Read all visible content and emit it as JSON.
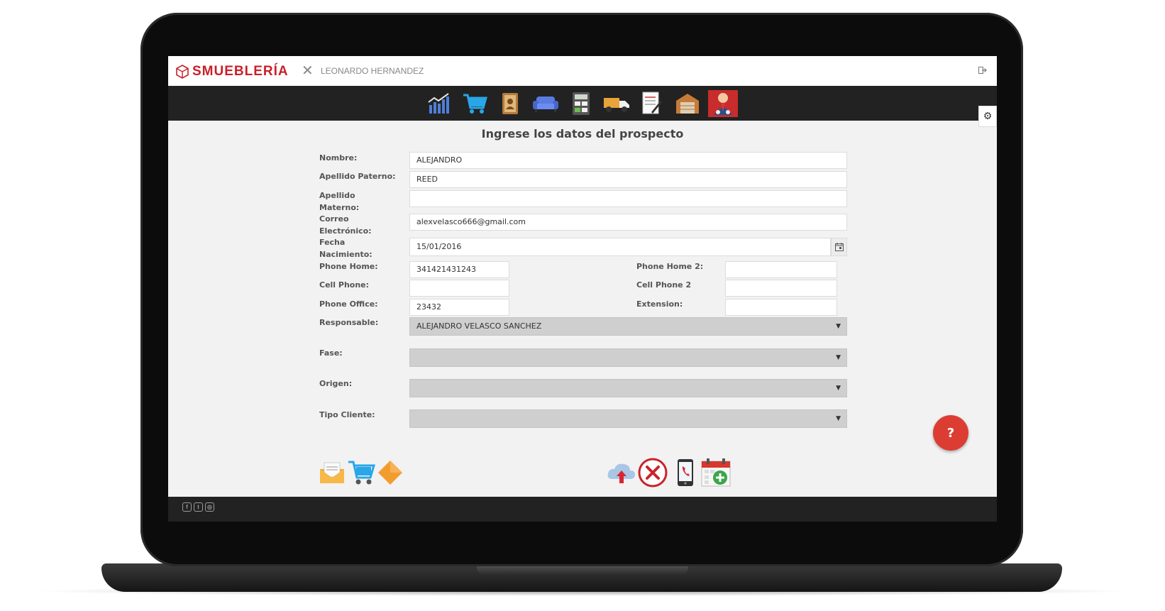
{
  "app": {
    "logo_text": "SMUEBLERÍA",
    "close_symbol": "✕",
    "user_name": "LEONARDO HERNANDEZ",
    "logout_icon": "logout-icon"
  },
  "nav": {
    "items": [
      "chart-icon",
      "cart-icon",
      "contacts-book-icon",
      "sofa-icon",
      "calculator-icon",
      "delivery-truck-icon",
      "document-edit-icon",
      "warehouse-icon",
      "salesperson-icon"
    ],
    "active_index": 8,
    "active_color": "#c82c2c"
  },
  "settings_icon": "⚙",
  "form": {
    "title": "Ingrese los datos del prospecto",
    "labels": {
      "nombre": "Nombre:",
      "apellido_paterno": "Apellido Paterno:",
      "apellido_materno": "Apellido Materno:",
      "correo": "Correo Electrónico:",
      "fecha": "Fecha Nacimiento:",
      "phone_home": "Phone Home:",
      "phone_home2": "Phone Home 2:",
      "cell_phone": "Cell Phone:",
      "cell_phone2": "Cell Phone 2",
      "phone_office": "Phone Office:",
      "extension": "Extension:",
      "responsable": "Responsable:",
      "fase": "Fase:",
      "origen": "Origen:",
      "tipo_cliente": "Tipo Cliente:"
    },
    "values": {
      "nombre": "ALEJANDRO",
      "apellido_paterno": "REED",
      "apellido_materno": "",
      "correo": "alexvelasco666@gmail.com",
      "fecha": "15/01/2016",
      "phone_home": "341421431243",
      "phone_home2": "",
      "cell_phone": "",
      "cell_phone2": "",
      "phone_office": "23432",
      "extension": "",
      "responsable": "ALEJANDRO VELASCO SANCHEZ",
      "fase": "",
      "origen": "",
      "tipo_cliente": ""
    }
  },
  "actions_left": [
    "email-icon",
    "shopping-cart-icon",
    "tag-icon"
  ],
  "actions_right": [
    "cloud-upload-icon",
    "cancel-icon",
    "mobile-phone-icon",
    "calendar-add-icon"
  ],
  "help_label": "?",
  "footer": {
    "social": [
      "f",
      "t",
      "◎"
    ]
  }
}
